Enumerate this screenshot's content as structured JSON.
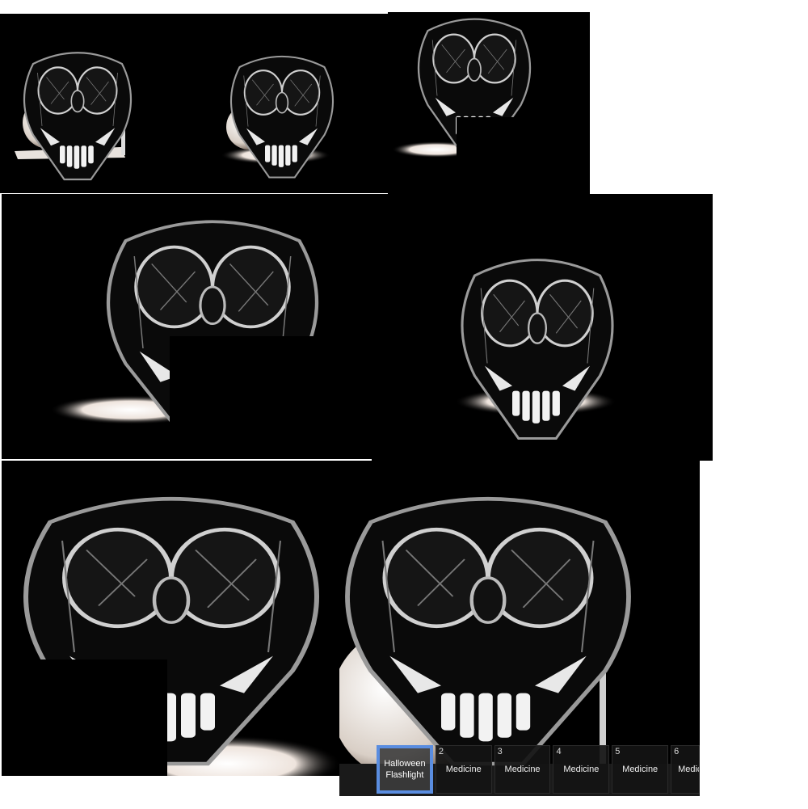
{
  "scene": {
    "subject": "monster-face",
    "colors": {
      "background": "#000000",
      "page": "#ffffff",
      "glow": "#f3ece6",
      "selection": "#5a8de0"
    }
  },
  "hotbar": {
    "slots": [
      {
        "num": "",
        "label": "Halloween Flashlight",
        "selected": true
      },
      {
        "num": "2",
        "label": "Medicine",
        "selected": false
      },
      {
        "num": "3",
        "label": "Medicine",
        "selected": false
      },
      {
        "num": "4",
        "label": "Medicine",
        "selected": false
      },
      {
        "num": "5",
        "label": "Medicine",
        "selected": false
      },
      {
        "num": "6",
        "label": "Medicine",
        "selected": false
      }
    ]
  }
}
